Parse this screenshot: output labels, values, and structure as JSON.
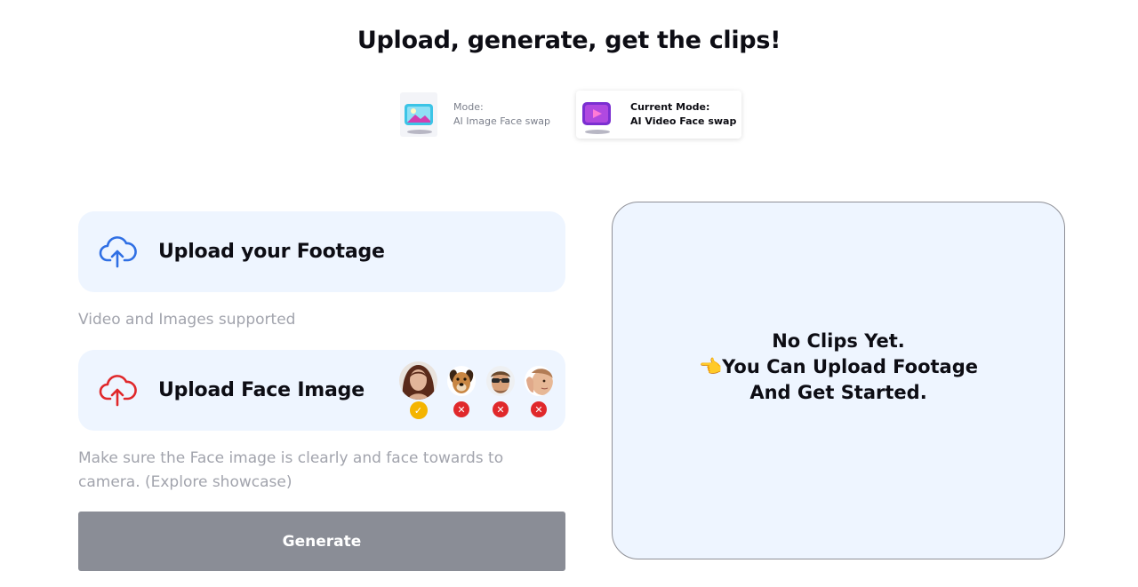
{
  "header": {
    "title": "Upload, generate, get the clips!"
  },
  "modes": [
    {
      "heading": "Mode:",
      "name": "AI Image Face swap",
      "icon": "image-icon",
      "active": false
    },
    {
      "heading": "Current Mode:",
      "name": "AI Video Face swap",
      "icon": "video-play-icon",
      "active": true
    }
  ],
  "footage": {
    "label": "Upload your Footage",
    "hint": "Video and Images supported",
    "icon": "cloud-upload-icon",
    "color": "#2f6fe4"
  },
  "face": {
    "label": "Upload Face Image",
    "hint": "Make sure the Face image is clearly and face towards to camera. (Explore showcase)",
    "icon": "cloud-upload-icon",
    "color": "#e0282b",
    "examples": [
      {
        "icon": "woman-face-icon",
        "status": "check-icon",
        "valid": true
      },
      {
        "icon": "dog-face-icon",
        "status": "x-icon",
        "valid": false
      },
      {
        "icon": "man-sunglasses-face-icon",
        "status": "x-icon",
        "valid": false
      },
      {
        "icon": "face-partial-icon",
        "status": "x-icon",
        "valid": false
      }
    ]
  },
  "generate": {
    "label": "Generate",
    "color": "#8a8d96"
  },
  "preview": {
    "line1": "No Clips Yet.",
    "line2": "👈You Can Upload Footage",
    "line3": "And Get Started."
  }
}
